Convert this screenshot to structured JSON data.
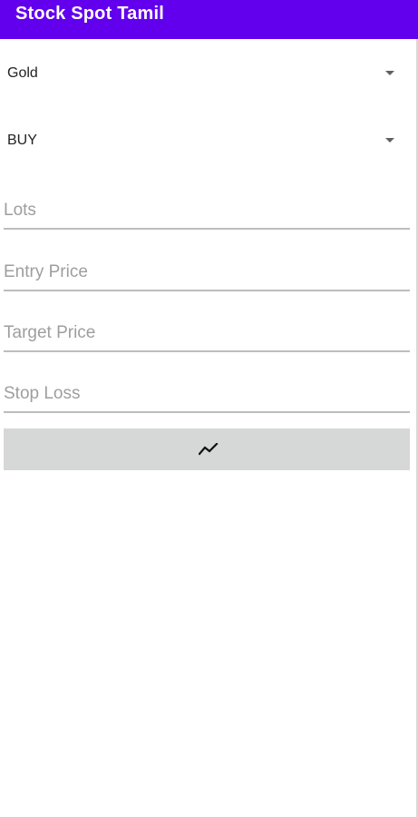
{
  "app_bar": {
    "title": "Stock Spot Tamil",
    "color": "#6200ee"
  },
  "form": {
    "commodity_selected": "Gold",
    "trade_type_selected": "BUY",
    "lots": {
      "value": "",
      "placeholder": "Lots"
    },
    "entry_price": {
      "value": "",
      "placeholder": "Entry Price"
    },
    "target_price": {
      "value": "",
      "placeholder": "Target Price"
    },
    "stop_loss": {
      "value": "",
      "placeholder": "Stop Loss"
    },
    "submit_button": {
      "icon": "trending-up-icon",
      "color": "#d6d7d7"
    }
  }
}
